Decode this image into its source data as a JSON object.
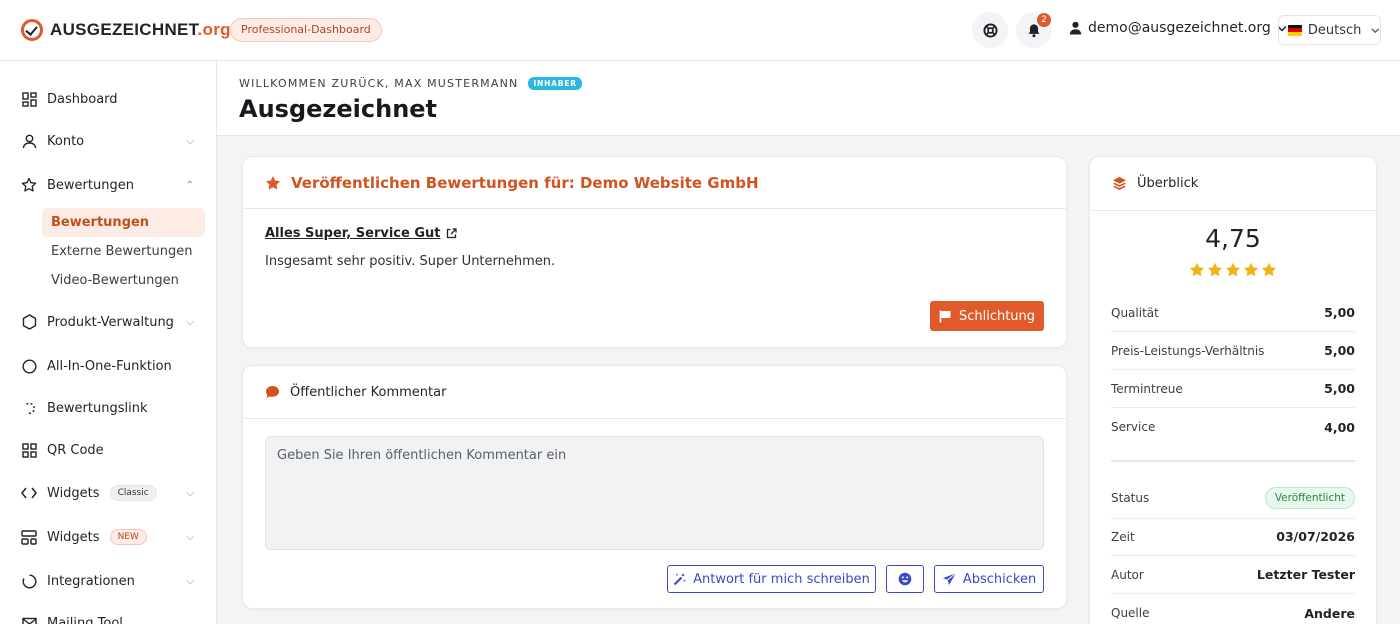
{
  "header": {
    "logo_main": "AUSGEZEICHNET",
    "logo_tld": ".org",
    "badge": "Professional-Dashboard",
    "notification_count": "2",
    "user_email": "demo@ausgezeichnet.org",
    "language": "Deutsch"
  },
  "sidebar": {
    "items": [
      {
        "label": "Dashboard"
      },
      {
        "label": "Konto"
      },
      {
        "label": "Bewertungen"
      },
      {
        "label": "Produkt-Verwaltung"
      },
      {
        "label": "All-In-One-Funktion"
      },
      {
        "label": "Bewertungslink"
      },
      {
        "label": "QR Code"
      },
      {
        "label": "Widgets",
        "tag": "Classic"
      },
      {
        "label": "Widgets",
        "tag": "NEW"
      },
      {
        "label": "Integrationen"
      },
      {
        "label": "Mailing Tool"
      }
    ],
    "sub_items": [
      {
        "label": "Bewertungen",
        "active": true
      },
      {
        "label": "Externe Bewertungen"
      },
      {
        "label": "Video-Bewertungen"
      }
    ]
  },
  "page": {
    "welcome": "WILLKOMMEN ZURÜCK, MAX MUSTERMANN",
    "role": "INHABER",
    "title": "Ausgezeichnet"
  },
  "review_card": {
    "heading": "Veröffentlichen Bewertungen für: Demo Website GmbH",
    "review_title": "Alles Super, Service Gut",
    "review_text": "Insgesamt sehr positiv. Super Unternehmen.",
    "dispute_button": "Schlichtung"
  },
  "comment_card": {
    "heading": "Öffentlicher Kommentar",
    "placeholder": "Geben Sie Ihren öffentlichen Kommentar ein",
    "ai_button": "Antwort für mich schreiben",
    "send_button": "Abschicken"
  },
  "overview": {
    "heading": "Überblick",
    "rating": "4,75",
    "stars": 4.75,
    "criteria": [
      {
        "label": "Qualität",
        "value": "5,00"
      },
      {
        "label": "Preis-Leistungs-Verhältnis",
        "value": "5,00"
      },
      {
        "label": "Termintreue",
        "value": "5,00"
      },
      {
        "label": "Service",
        "value": "4,00"
      }
    ],
    "status_label": "Status",
    "status_value": "Veröffentlicht",
    "details": [
      {
        "label": "Zeit",
        "value": "03/07/2026"
      },
      {
        "label": "Autor",
        "value": "Letzter Tester"
      },
      {
        "label": "Quelle",
        "value": "Andere"
      }
    ]
  },
  "colors": {
    "brand": "#e05a2b",
    "link_blue": "#3a4bc7",
    "star": "#f2b21b",
    "success": "#1f8a43"
  }
}
